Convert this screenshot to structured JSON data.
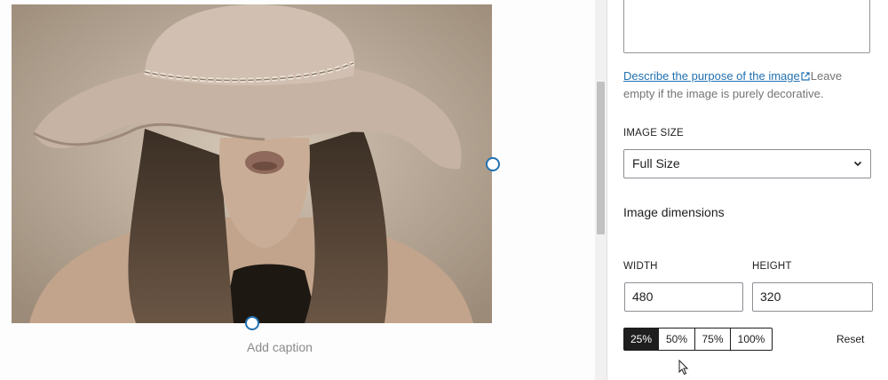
{
  "editor": {
    "caption_placeholder": "Add caption",
    "image_description": "sepia photo of a woman in a wide-brim hat"
  },
  "sidebar": {
    "alt_text_value": "",
    "help_link": "Describe the purpose of the image",
    "help_rest": "Leave empty if the image is purely decorative.",
    "image_size_label": "IMAGE SIZE",
    "image_size_value": "Full Size",
    "dimensions_title": "Image dimensions",
    "width_label": "WIDTH",
    "height_label": "HEIGHT",
    "width_value": "480",
    "height_value": "320",
    "percent_buttons": [
      "25%",
      "50%",
      "75%",
      "100%"
    ],
    "active_percent": "25%",
    "reset_label": "Reset"
  },
  "colors": {
    "accent": "#2271b1",
    "dark": "#1e1e1e"
  }
}
